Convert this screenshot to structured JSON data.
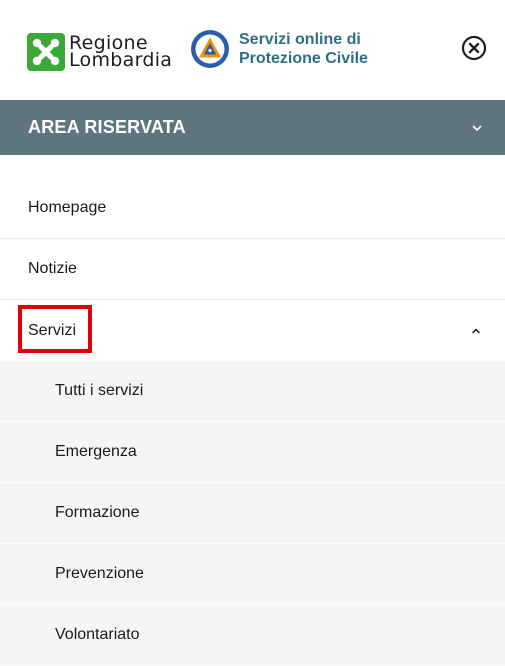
{
  "header": {
    "logo_rl_line1": "Regione",
    "logo_rl_line2": "Lombardia",
    "logo_pc_line1": "Servizi online di",
    "logo_pc_line2": "Protezione Civile",
    "close_icon": "close-circle-icon"
  },
  "area_bar": {
    "title": "AREA RISERVATA",
    "icon": "chevron-down-icon"
  },
  "menu": {
    "items": [
      {
        "label": "Homepage"
      },
      {
        "label": "Notizie"
      },
      {
        "label": "Servizi",
        "expanded": true,
        "icon": "chevron-up-icon"
      }
    ],
    "subitems": [
      {
        "label": "Tutti i servizi"
      },
      {
        "label": "Emergenza"
      },
      {
        "label": "Formazione"
      },
      {
        "label": "Prevenzione"
      },
      {
        "label": "Volontariato"
      }
    ]
  },
  "colors": {
    "area_bar_bg": "#5f7681",
    "pc_text": "#2d6f82",
    "rl_green": "#3aa935",
    "highlight": "#e3000b",
    "submenu_bg": "#f4f5f6"
  }
}
